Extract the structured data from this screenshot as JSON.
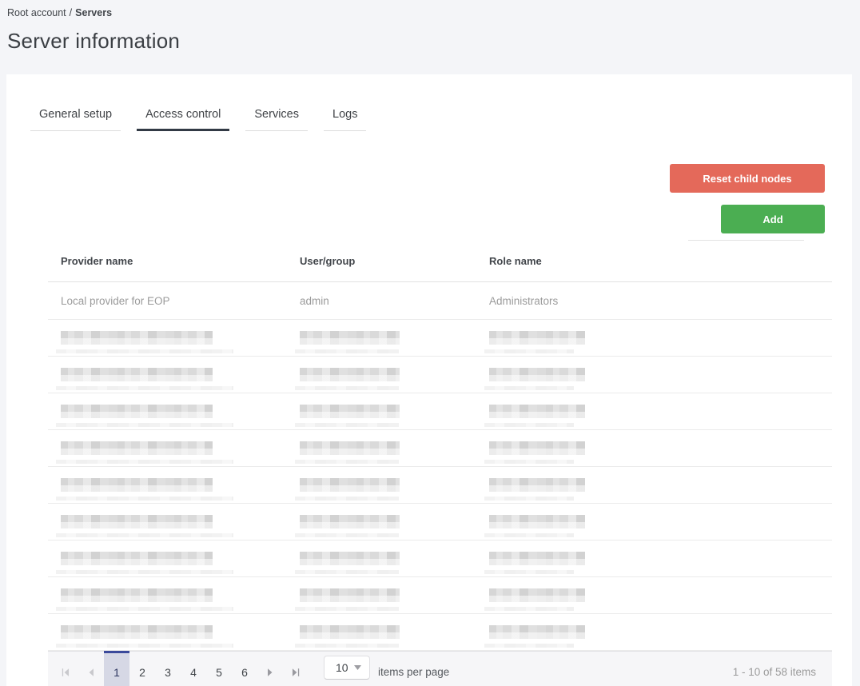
{
  "breadcrumb": {
    "parent": "Root account",
    "separator": "/",
    "current": "Servers"
  },
  "page": {
    "title": "Server information"
  },
  "tabs": [
    {
      "label": "General setup",
      "active": false
    },
    {
      "label": "Access control",
      "active": true
    },
    {
      "label": "Services",
      "active": false
    },
    {
      "label": "Logs",
      "active": false
    }
  ],
  "toolbar": {
    "reset_label": "Reset child nodes",
    "add_label": "Add"
  },
  "table": {
    "columns": [
      "Provider name",
      "User/group",
      "Role name"
    ],
    "rows": [
      {
        "redacted": false,
        "provider_name": "Local provider for EOP",
        "user_group": "admin",
        "role_name": "Administrators"
      },
      {
        "redacted": true
      },
      {
        "redacted": true
      },
      {
        "redacted": true
      },
      {
        "redacted": true
      },
      {
        "redacted": true
      },
      {
        "redacted": true
      },
      {
        "redacted": true
      },
      {
        "redacted": true
      },
      {
        "redacted": true
      }
    ]
  },
  "pager": {
    "icons": [
      "first-page-icon",
      "previous-page-icon",
      "next-page-icon",
      "last-page-icon",
      "dropdown-caret-icon"
    ],
    "pages": [
      "1",
      "2",
      "3",
      "4",
      "5",
      "6"
    ],
    "selected_page": "1",
    "page_size_value": "10",
    "items_per_page_label": "items per page",
    "range_label": "1 - 10 of 58 items"
  },
  "colors": {
    "page_background": "#f4f5f8",
    "reset_button": "#e4695a",
    "add_button": "#4bae52",
    "active_tab_underline": "#323a45",
    "selected_page_accent": "#3b4a9b",
    "selected_page_background": "#d6d8e5",
    "muted_row_text": "#9b9b9b"
  }
}
